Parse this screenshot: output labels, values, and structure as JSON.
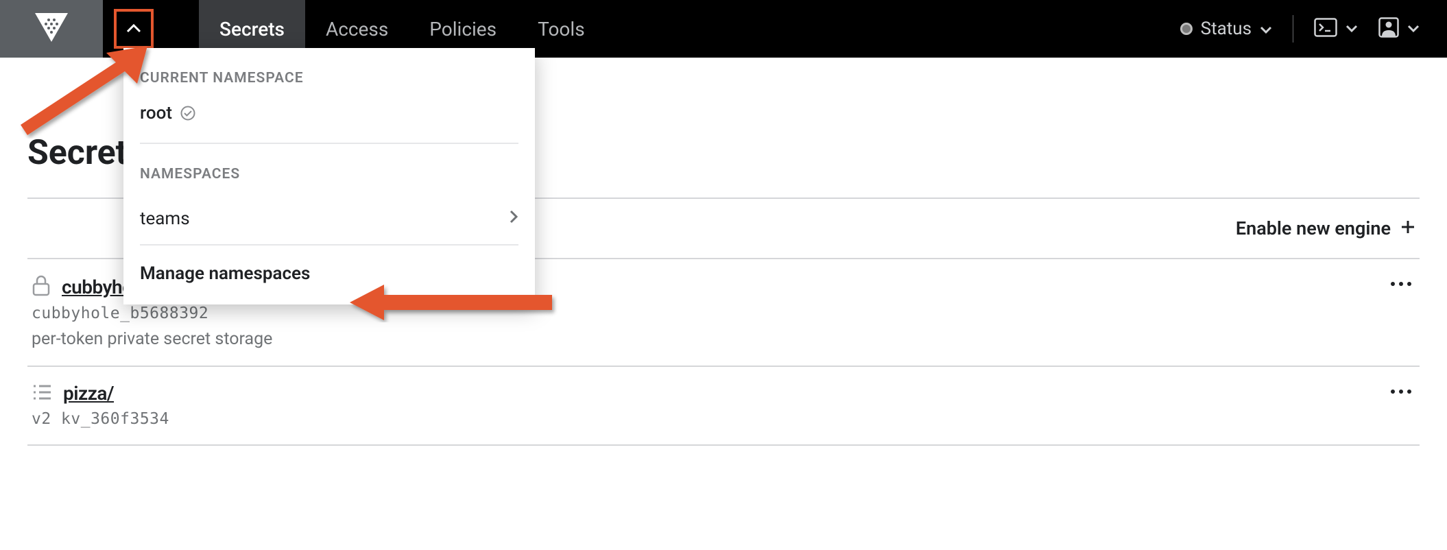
{
  "nav": {
    "tabs": [
      "Secrets",
      "Access",
      "Policies",
      "Tools"
    ],
    "active": "Secrets"
  },
  "status": {
    "label": "Status"
  },
  "namespace_dropdown": {
    "current_header": "CURRENT NAMESPACE",
    "current_value": "root",
    "list_header": "NAMESPACES",
    "items": [
      "teams"
    ],
    "manage_label": "Manage namespaces"
  },
  "page": {
    "title": "Secrets Engines",
    "enable_label": "Enable new engine"
  },
  "engines": [
    {
      "name": "cubbyhole/",
      "id": "cubbyhole_b5688392",
      "description": "per-token private secret storage",
      "icon": "lock"
    },
    {
      "name": "pizza/",
      "id": "v2 kv_360f3534",
      "description": "",
      "icon": "list"
    }
  ]
}
